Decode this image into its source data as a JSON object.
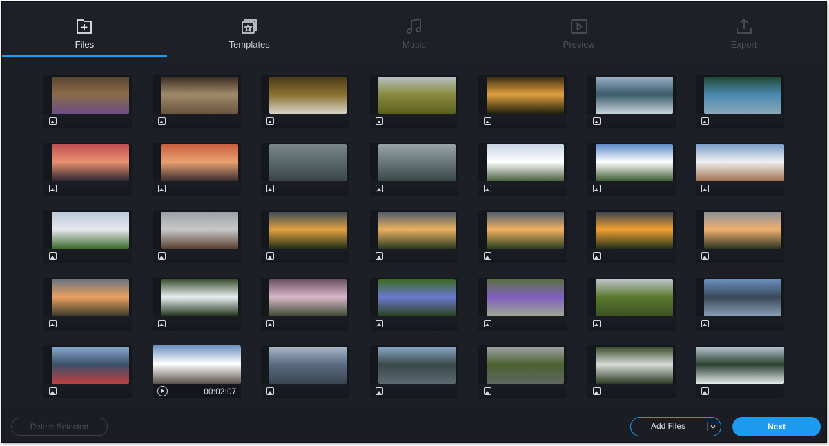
{
  "steps": [
    {
      "id": "files",
      "label": "Files",
      "state": "active",
      "icon": "file-add-icon"
    },
    {
      "id": "templates",
      "label": "Templates",
      "state": "enabled",
      "icon": "templates-star-icon"
    },
    {
      "id": "music",
      "label": "Music",
      "state": "disabled",
      "icon": "music-note-icon"
    },
    {
      "id": "preview",
      "label": "Preview",
      "state": "disabled",
      "icon": "preview-play-icon"
    },
    {
      "id": "export",
      "label": "Export",
      "state": "disabled",
      "icon": "export-upload-icon"
    }
  ],
  "colors": {
    "accent": "#1d9bf0",
    "background": "#1c1f26",
    "disabled_text": "#4b4f58"
  },
  "media": [
    {
      "type": "image",
      "icon": "image-icon",
      "thumb": "flowers on wood",
      "colors": [
        "#5a4530",
        "#8a6a4a",
        "#6b4f86"
      ]
    },
    {
      "type": "image",
      "icon": "image-icon",
      "thumb": "book with dried flowers",
      "colors": [
        "#3a2c22",
        "#a08a6a",
        "#6b5440"
      ]
    },
    {
      "type": "image",
      "icon": "image-icon",
      "thumb": "hillside and sky",
      "colors": [
        "#4a3a18",
        "#8a7030",
        "#d8d4c8"
      ]
    },
    {
      "type": "image",
      "icon": "image-icon",
      "thumb": "path through field",
      "colors": [
        "#b8c2c6",
        "#8a8a40",
        "#5a6020"
      ]
    },
    {
      "type": "image",
      "icon": "image-icon",
      "thumb": "forest sunset",
      "colors": [
        "#3a2a10",
        "#e0a040",
        "#20200c"
      ]
    },
    {
      "type": "image",
      "icon": "image-icon",
      "thumb": "mountain lake",
      "colors": [
        "#9ab0c8",
        "#3a5a6a",
        "#c8d4dc"
      ]
    },
    {
      "type": "image",
      "icon": "image-icon",
      "thumb": "lake shore",
      "colors": [
        "#204830",
        "#4a88b0",
        "#8aa8b8"
      ]
    },
    {
      "type": "image",
      "icon": "image-icon",
      "thumb": "pink sunset beach",
      "colors": [
        "#c05050",
        "#e89070",
        "#2a2430"
      ]
    },
    {
      "type": "image",
      "icon": "image-icon",
      "thumb": "orange sunset beach",
      "colors": [
        "#c86040",
        "#e8a070",
        "#3a2c30"
      ]
    },
    {
      "type": "image",
      "icon": "image-icon",
      "thumb": "grey ocean waves",
      "colors": [
        "#7a8688",
        "#5a686a",
        "#3a4446"
      ]
    },
    {
      "type": "image",
      "icon": "image-icon",
      "thumb": "grey sea",
      "colors": [
        "#9aa4a6",
        "#6a787a",
        "#3a4646"
      ]
    },
    {
      "type": "image",
      "icon": "image-icon",
      "thumb": "snowy mountains clouds",
      "colors": [
        "#c8d4e2",
        "#ffffff",
        "#4a6040"
      ]
    },
    {
      "type": "image",
      "icon": "image-icon",
      "thumb": "volcano peak",
      "colors": [
        "#5a8ac8",
        "#ffffff",
        "#3a5a30"
      ]
    },
    {
      "type": "image",
      "icon": "image-icon",
      "thumb": "wide clouds valley",
      "colors": [
        "#7aa0c8",
        "#f0f0f0",
        "#a07050"
      ]
    },
    {
      "type": "image",
      "icon": "image-icon",
      "thumb": "snowy range meadow",
      "colors": [
        "#b8c8d8",
        "#e8e8ee",
        "#3a6a2a"
      ]
    },
    {
      "type": "image",
      "icon": "image-icon",
      "thumb": "misty mountain",
      "colors": [
        "#9aa0a4",
        "#c8c8c8",
        "#5a4030"
      ]
    },
    {
      "type": "image",
      "icon": "image-icon",
      "thumb": "sunset over hills",
      "colors": [
        "#3a4a58",
        "#e0a040",
        "#203018"
      ]
    },
    {
      "type": "image",
      "icon": "image-icon",
      "thumb": "sunset river valley",
      "colors": [
        "#4a5a6a",
        "#e8b060",
        "#2a3a20"
      ]
    },
    {
      "type": "image",
      "icon": "image-icon",
      "thumb": "sunset river valley 2",
      "colors": [
        "#4a5c70",
        "#f0b060",
        "#2a4020"
      ]
    },
    {
      "type": "image",
      "icon": "image-icon",
      "thumb": "sun behind hills",
      "colors": [
        "#3a4450",
        "#f0a030",
        "#203018"
      ]
    },
    {
      "type": "image",
      "icon": "image-icon",
      "thumb": "cloudy sunset",
      "colors": [
        "#8a9098",
        "#f0b070",
        "#2a3420"
      ]
    },
    {
      "type": "image",
      "icon": "image-icon",
      "thumb": "dusk hill",
      "colors": [
        "#6a7480",
        "#e8a060",
        "#3a3828"
      ]
    },
    {
      "type": "image",
      "icon": "image-icon",
      "thumb": "waterfall",
      "colors": [
        "#3a5030",
        "#e8eef0",
        "#203018"
      ]
    },
    {
      "type": "image",
      "icon": "image-icon",
      "thumb": "pink wildflowers",
      "colors": [
        "#6a5060",
        "#d8b8c8",
        "#3a4a30"
      ]
    },
    {
      "type": "image",
      "icon": "image-icon",
      "thumb": "blue flower",
      "colors": [
        "#3a6a20",
        "#6a7ad0",
        "#2a4018"
      ]
    },
    {
      "type": "image",
      "icon": "image-icon",
      "thumb": "purple flowers stream",
      "colors": [
        "#5a7040",
        "#8060c0",
        "#a0a890"
      ]
    },
    {
      "type": "image",
      "icon": "image-icon",
      "thumb": "green valley",
      "colors": [
        "#c0c4c8",
        "#5a7a30",
        "#3a5020"
      ]
    },
    {
      "type": "image",
      "icon": "image-icon",
      "thumb": "sea and island",
      "colors": [
        "#6a90c0",
        "#3a4858",
        "#8aa0b8"
      ]
    },
    {
      "type": "image",
      "icon": "image-icon",
      "thumb": "ship at sea",
      "colors": [
        "#8aaad0",
        "#3a5068",
        "#c04040"
      ]
    },
    {
      "type": "video",
      "icon": "play-icon",
      "duration": "00:02:07",
      "thumb": "snowy mountain peaks",
      "colors": [
        "#6a90c0",
        "#ffffff",
        "#5a5048"
      ]
    },
    {
      "type": "image",
      "icon": "image-icon",
      "thumb": "volcano over sea",
      "colors": [
        "#a8b8c8",
        "#5a6a80",
        "#3a4450"
      ]
    },
    {
      "type": "image",
      "icon": "image-icon",
      "thumb": "mountains and sea",
      "colors": [
        "#8aa8c8",
        "#3a4a48",
        "#5a6a70"
      ]
    },
    {
      "type": "image",
      "icon": "image-icon",
      "thumb": "overcast plain",
      "colors": [
        "#a0a4a8",
        "#4a6030",
        "#606860"
      ]
    },
    {
      "type": "image",
      "icon": "image-icon",
      "thumb": "animal in grass",
      "colors": [
        "#3a4a2a",
        "#d8dcd8",
        "#2a3820"
      ]
    },
    {
      "type": "image",
      "icon": "image-icon",
      "thumb": "glacier valley",
      "colors": [
        "#b8c4d0",
        "#2a4030",
        "#e8ecee"
      ]
    }
  ],
  "bottom": {
    "delete_label": "Delete Selected",
    "add_files_label": "Add Files",
    "next_label": "Next"
  }
}
